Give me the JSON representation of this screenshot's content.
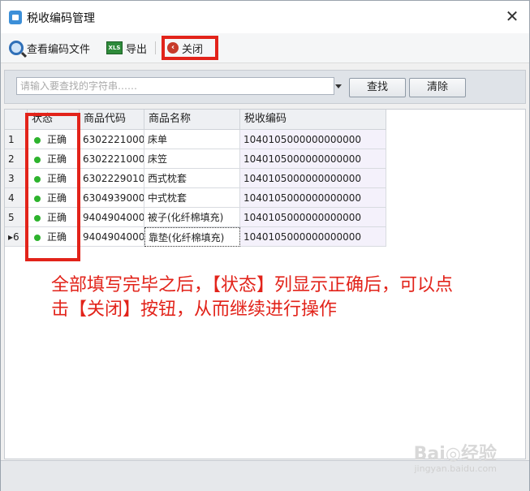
{
  "window": {
    "title": "税收编码管理"
  },
  "toolbar": {
    "view_label": "查看编码文件",
    "export_label": "导出",
    "export_icon_text": "XLS",
    "close_label": "关闭"
  },
  "search": {
    "placeholder": "请输入要查找的字符串……",
    "find_label": "查找",
    "clear_label": "清除"
  },
  "grid": {
    "headers": [
      "状态",
      "商品代码",
      "商品名称",
      "税收编码"
    ],
    "rows": [
      {
        "num": "1",
        "status": "正确",
        "code": "6302221000",
        "name": "床单",
        "tax_code": "1040105000000000000"
      },
      {
        "num": "2",
        "status": "正确",
        "code": "6302221000",
        "name": "床笠",
        "tax_code": "1040105000000000000"
      },
      {
        "num": "3",
        "status": "正确",
        "code": "6302229010",
        "name": "西式枕套",
        "tax_code": "1040105000000000000"
      },
      {
        "num": "4",
        "status": "正确",
        "code": "6304939000",
        "name": "中式枕套",
        "tax_code": "1040105000000000000"
      },
      {
        "num": "5",
        "status": "正确",
        "code": "9404904000",
        "name": "被子(化纤棉填充)",
        "tax_code": "1040105000000000000"
      },
      {
        "num": "6",
        "status": "正确",
        "code": "9404904000",
        "name": "靠垫(化纤棉填充)",
        "tax_code": "1040105000000000000"
      }
    ],
    "current_row_marker": "▸"
  },
  "annotation": {
    "line1": "全部填写完毕之后，【状态】列显示正确后，可以点",
    "line2": "击【关闭】按钮，从而继续进行操作"
  },
  "watermark": {
    "text": "Bai◎经验",
    "sub": "jingyan.baidu.com"
  },
  "colors": {
    "highlight_red": "#e2231a",
    "status_ok": "#2db32d"
  },
  "icons": {
    "title": "app-icon",
    "view": "search-icon",
    "export": "excel-icon",
    "close": "close-circle-icon",
    "window_close": "close-icon",
    "dropdown": "chevron-down-icon"
  }
}
